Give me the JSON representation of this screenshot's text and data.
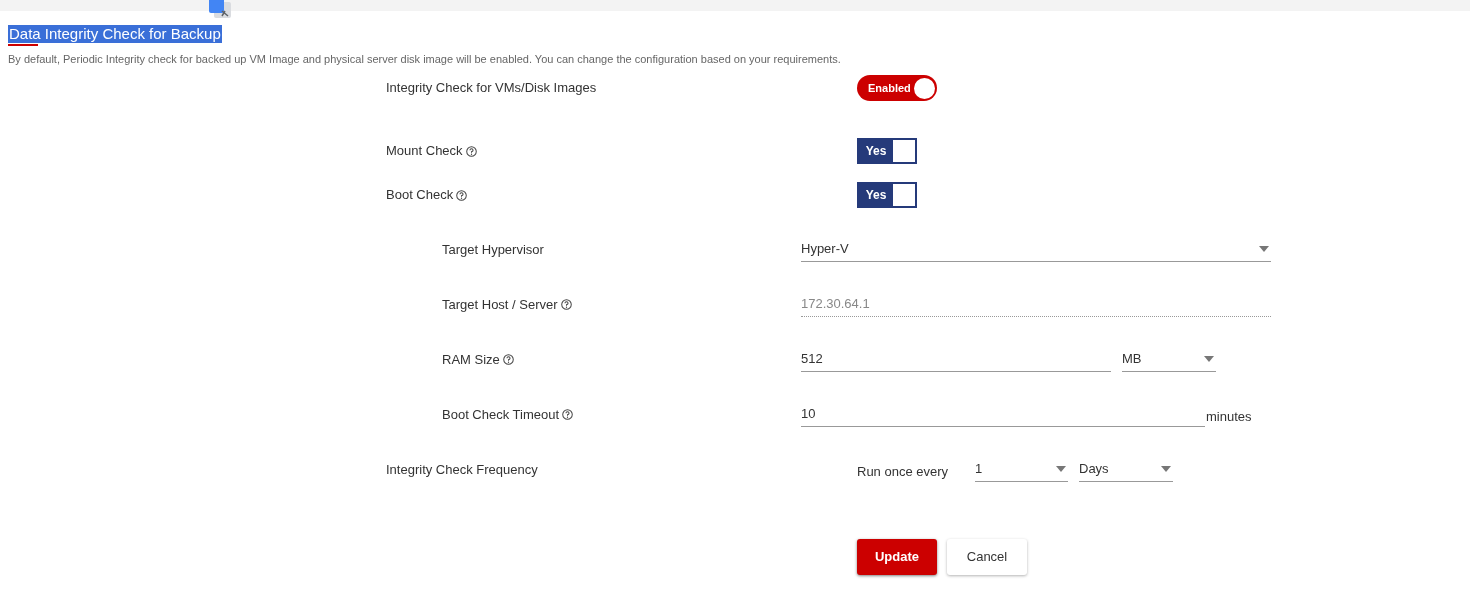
{
  "page": {
    "title": "Data Integrity Check for Backup",
    "description": "By default, Periodic Integrity check for backed up VM Image and physical server disk image will be enabled. You can change the configuration based on your requirements."
  },
  "settings": [
    {
      "kind": "pill",
      "label": "Integrity Check for VMs/Disk Images",
      "help": false,
      "on": true,
      "text": "Enabled"
    },
    {
      "kind": "box",
      "label": "Mount Check",
      "help": true,
      "on": true,
      "text": "Yes"
    },
    {
      "kind": "box",
      "label": "Boot Check",
      "help": true,
      "on": true,
      "text": "Yes",
      "children": [
        {
          "kind": "select",
          "label": "Target Hypervisor",
          "help": false,
          "value": "Hyper-V"
        },
        {
          "kind": "readonly",
          "label": "Target Host / Server",
          "help": true,
          "value": "172.30.64.1"
        },
        {
          "kind": "input_unit",
          "label": "RAM Size",
          "help": true,
          "value": "512",
          "unit": "MB"
        },
        {
          "kind": "input_suffix",
          "label": "Boot Check Timeout",
          "help": true,
          "value": "10",
          "suffix": "minutes"
        }
      ]
    },
    {
      "kind": "frequency",
      "label": "Integrity Check Frequency",
      "help": false,
      "prefix": "Run once every",
      "value": "1",
      "unit": "Days"
    }
  ],
  "buttons": [
    {
      "kind": "primary",
      "label": "Update"
    },
    {
      "kind": "secondary",
      "label": "Cancel"
    }
  ]
}
